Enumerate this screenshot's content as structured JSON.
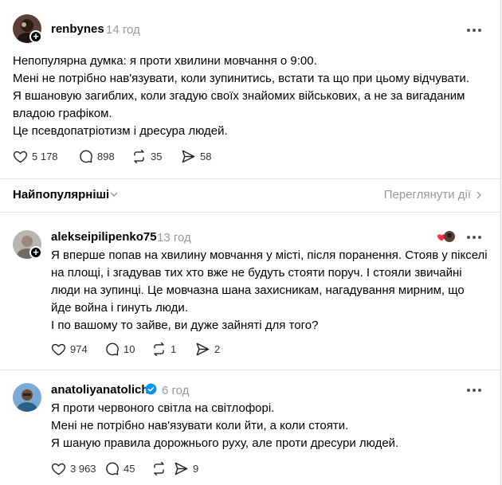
{
  "colors": {
    "verified": "#0095f6",
    "heart": "#ff3040",
    "muted": "#999999"
  },
  "main_post": {
    "username": "renbynes",
    "time": "14 год",
    "lines": [
      "Непопулярна думка: я проти хвилини мовчання о 9:00.",
      "Мені не потрібно нав'язувати, коли зупинитись, встати та що при цьому відчувати.",
      "Я вшановую загиблих, коли згадую своїх знайомих військових, а не за вигаданим",
      "владою графіком.",
      "Це псевдопатріотизм і дресура людей."
    ],
    "likes": "5 178",
    "replies": "898",
    "reposts": "35",
    "shares": "58"
  },
  "sort": {
    "label": "Найпопулярніші",
    "view_activity": "Переглянути дії"
  },
  "replies": [
    {
      "username": "alekseipilipenko75",
      "time": "13 год",
      "lines": [
        "Я вперше попав на хвилину мовчання у місті, після поранення. Стояв у пікселі",
        "на площі, і згадував тих хто вже не будуть стояти поруч. І стояли звичайні",
        "люди на зупинці. Це мовчазна шана захисникам, нагадування мирним, що",
        "йде война і гинуть люди.",
        "І по вашому то зайве, ви дуже зайняті для того?"
      ],
      "likes": "974",
      "replies": "10",
      "reposts": "1",
      "shares": "2"
    },
    {
      "username": "anatoliyanatolich",
      "time": "6 год",
      "verified": true,
      "lines": [
        "Я проти червоного світла на світлофорі.",
        "Мені не потрібно нав'язувати коли йти, а коли стояти.",
        "Я шаную правила дорожнього руху, але проти дресури людей."
      ],
      "likes": "3 963",
      "replies": "45",
      "reposts": "",
      "shares": "9"
    }
  ]
}
